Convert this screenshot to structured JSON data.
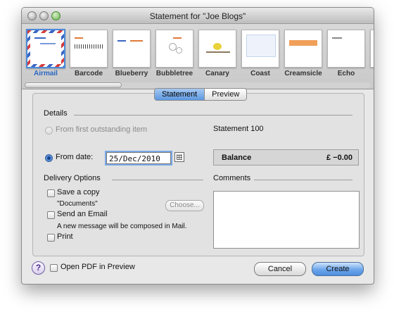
{
  "window": {
    "title": "Statement for \"Joe  Blogs\""
  },
  "templates": [
    {
      "name": "Airmail",
      "selected": true
    },
    {
      "name": "Barcode",
      "selected": false
    },
    {
      "name": "Blueberry",
      "selected": false
    },
    {
      "name": "Bubbletree",
      "selected": false
    },
    {
      "name": "Canary",
      "selected": false
    },
    {
      "name": "Coast",
      "selected": false
    },
    {
      "name": "Creamsicle",
      "selected": false
    },
    {
      "name": "Echo",
      "selected": false
    }
  ],
  "tabs": {
    "statement": "Statement",
    "preview": "Preview",
    "active": "Statement"
  },
  "details": {
    "heading": "Details",
    "from_first_label": "From first outstanding item",
    "from_date_label": "From date:",
    "from_date_value": "25/Dec/2010",
    "statement_number": "Statement 100",
    "balance_label": "Balance",
    "balance_value": "£ −0.00"
  },
  "delivery": {
    "heading": "Delivery Options",
    "save_copy_label": "Save a copy",
    "save_location": "\"Documents\"",
    "choose_label": "Choose...",
    "send_email_label": "Send an Email",
    "email_note": "A new message will be composed in Mail.",
    "print_label": "Print"
  },
  "comments": {
    "heading": "Comments",
    "value": ""
  },
  "footer": {
    "help": "?",
    "open_pdf_label": "Open PDF in Preview",
    "cancel_label": "Cancel",
    "create_label": "Create"
  },
  "colors": {
    "accent": "#4a8ad9",
    "default_button": "#5d98e2"
  }
}
